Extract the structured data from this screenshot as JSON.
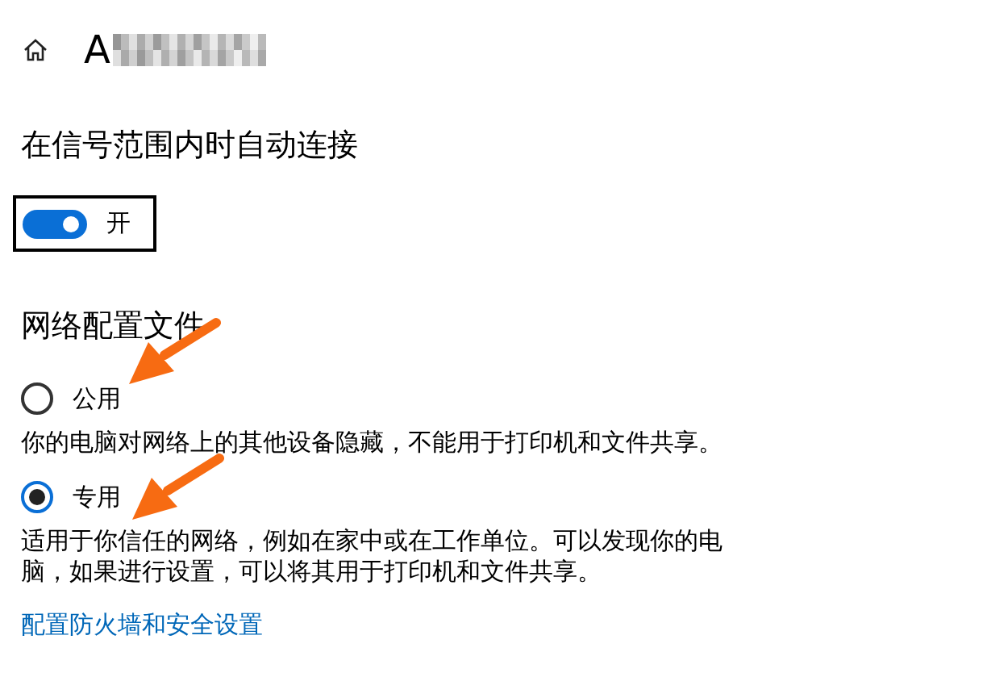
{
  "header": {
    "title": "A"
  },
  "auto_connect": {
    "heading": "在信号范围内时自动连接",
    "toggle": {
      "on": true,
      "label": "开"
    }
  },
  "network_profile": {
    "heading": "网络配置文件",
    "options": [
      {
        "label": "公用",
        "selected": false,
        "description": "你的电脑对网络上的其他设备隐藏，不能用于打印机和文件共享。"
      },
      {
        "label": "专用",
        "selected": true,
        "description": "适用于你信任的网络，例如在家中或在工作单位。可以发现你的电脑，如果进行设置，可以将其用于打印机和文件共享。"
      }
    ],
    "link": "配置防火墙和安全设置"
  }
}
